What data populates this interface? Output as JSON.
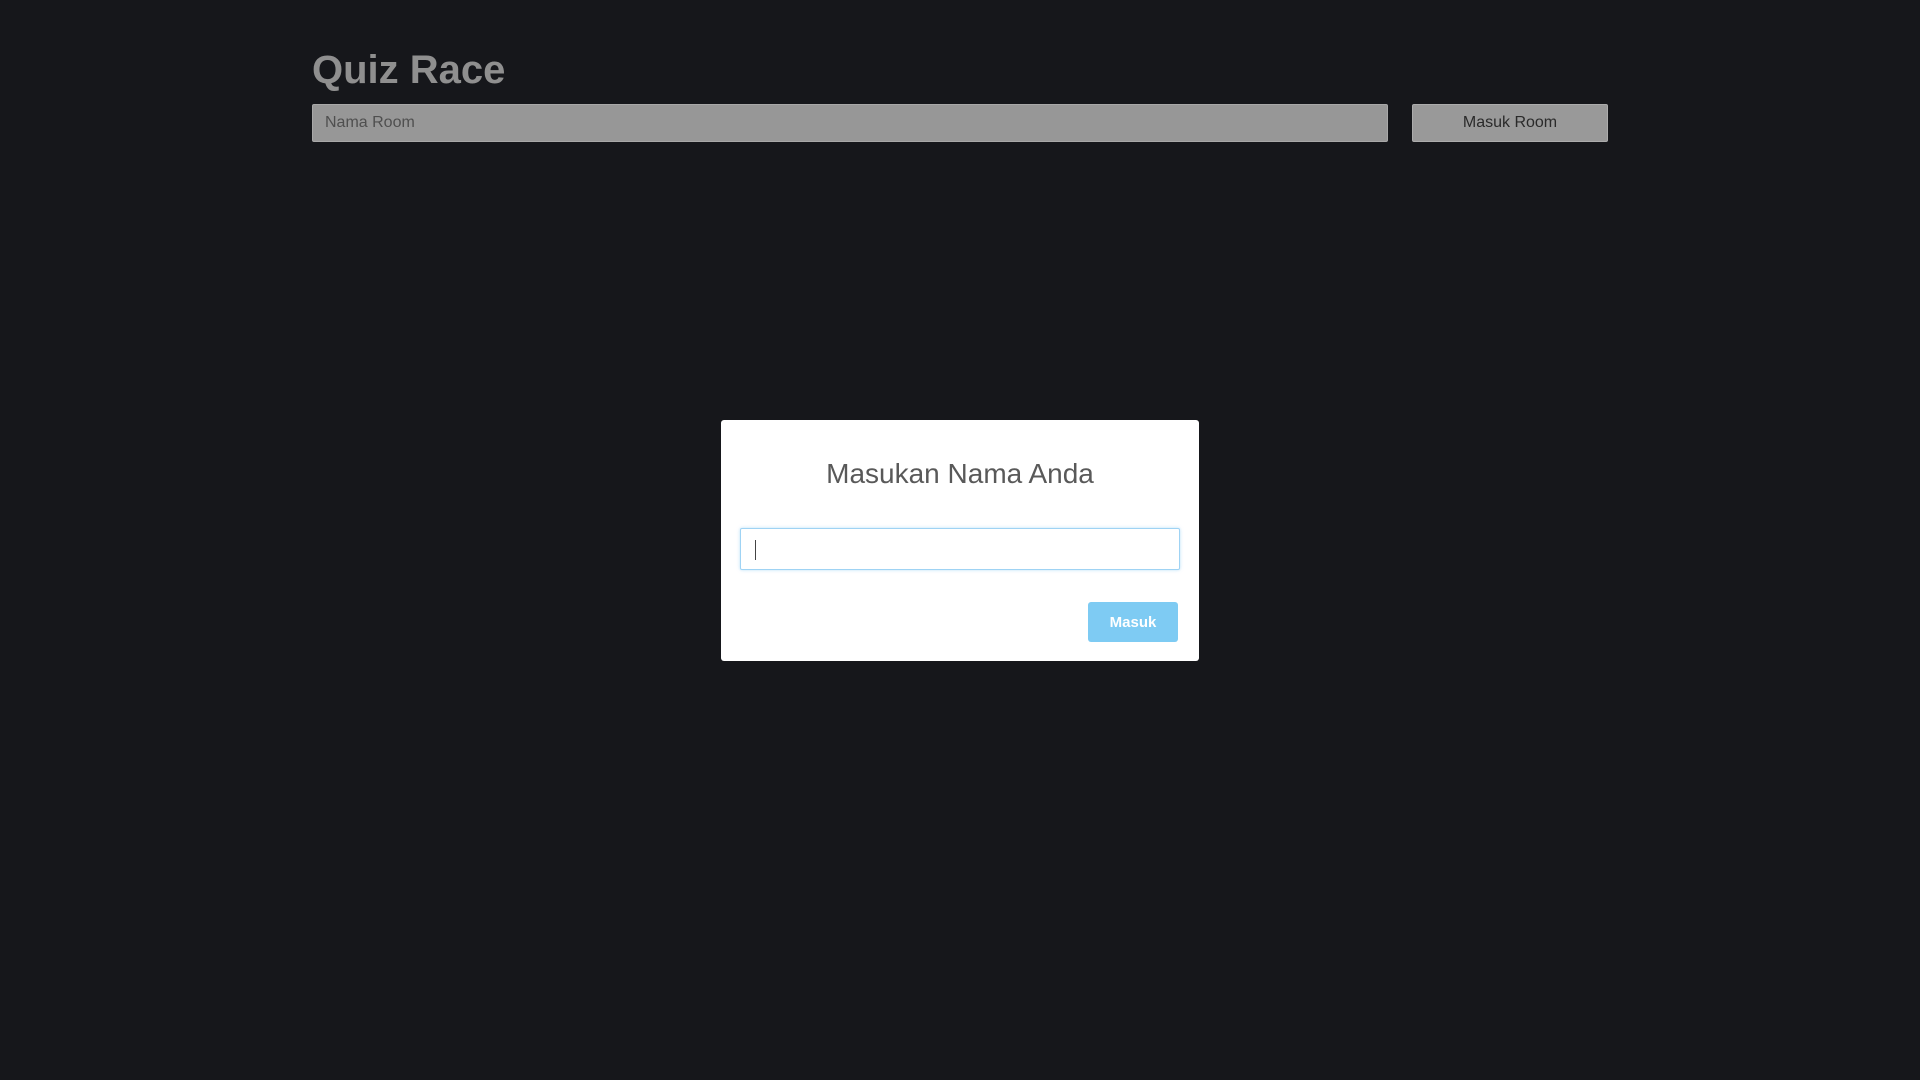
{
  "header": {
    "title": "Quiz Race"
  },
  "room_form": {
    "room_input_placeholder": "Nama Room",
    "room_input_value": "",
    "join_button_label": "Masuk Room"
  },
  "name_modal": {
    "title": "Masukan Nama Anda",
    "name_input_value": "",
    "submit_button_label": "Masuk",
    "submit_button_color": "#7ecbf3"
  },
  "colors": {
    "background": "#16171b",
    "modal_background": "#ffffff",
    "input_focus_border": "#9fd3f4"
  }
}
